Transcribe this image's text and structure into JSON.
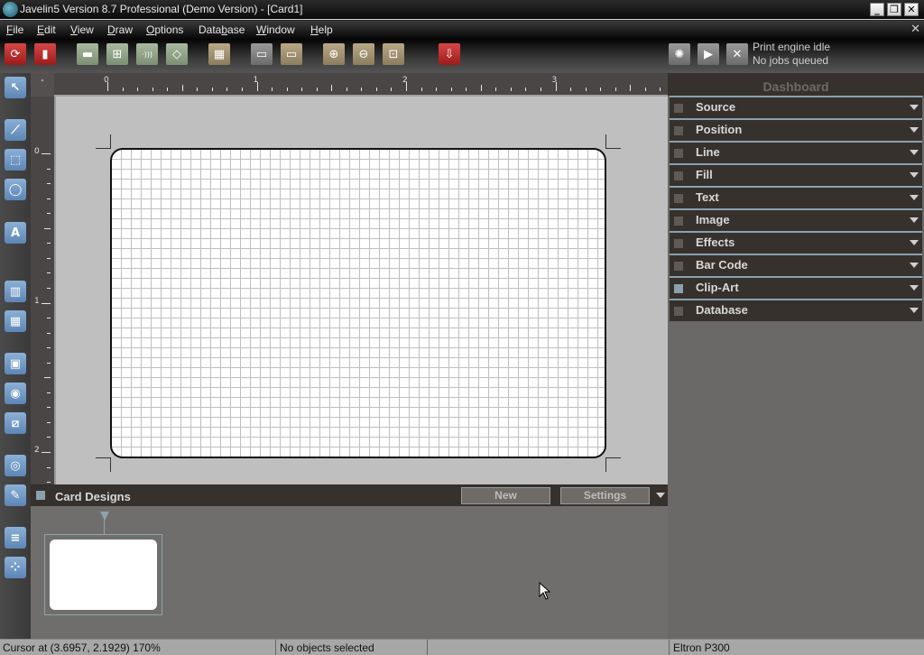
{
  "window": {
    "title": "Javelin5 Version 8.7 Professional (Demo Version) - [Card1]",
    "minimize": "_",
    "restore": "❐",
    "close": "✕",
    "mdi_close": "✕"
  },
  "menu": [
    {
      "label": "File",
      "u": "F",
      "rest": "ile"
    },
    {
      "label": "Edit",
      "u": "E",
      "rest": "dit"
    },
    {
      "label": "View",
      "u": "V",
      "rest": "iew"
    },
    {
      "label": "Draw",
      "u": "D",
      "rest": "raw"
    },
    {
      "label": "Options",
      "u": "O",
      "rest": "ptions"
    },
    {
      "label": "Database",
      "pre": "Data",
      "u": "b",
      "rest": "ase"
    },
    {
      "label": "Window",
      "u": "W",
      "rest": "indow"
    },
    {
      "label": "Help",
      "u": "H",
      "rest": "elp"
    }
  ],
  "toolbar": {
    "buttons": [
      {
        "name": "refresh-icon",
        "glyph": "⟳"
      },
      {
        "name": "ribbon-icon",
        "glyph": "▮"
      },
      {
        "name": "magstripe-icon",
        "glyph": "▬"
      },
      {
        "name": "smartchip-icon",
        "glyph": "⊞"
      },
      {
        "name": "contactless-icon",
        "glyph": "·)))"
      },
      {
        "name": "hologram-icon",
        "glyph": "◇"
      },
      {
        "name": "grid-icon",
        "glyph": "▦"
      },
      {
        "name": "card-front-icon",
        "glyph": "▭"
      },
      {
        "name": "card-flip-icon",
        "glyph": "▭"
      },
      {
        "name": "zoom-in-icon",
        "glyph": "⊕"
      },
      {
        "name": "zoom-out-icon",
        "glyph": "⊖"
      },
      {
        "name": "zoom-fit-icon",
        "glyph": "⊡"
      },
      {
        "name": "print-icon",
        "glyph": "⇩"
      },
      {
        "name": "print-settings-icon",
        "glyph": "✺"
      },
      {
        "name": "print-start-icon",
        "glyph": "▶"
      },
      {
        "name": "print-cancel-icon",
        "glyph": "✕"
      }
    ],
    "status_line1": "Print engine idle",
    "status_line2": "No jobs queued"
  },
  "tools": [
    {
      "name": "select-tool-icon",
      "glyph": "↖"
    },
    {
      "name": "line-tool-icon",
      "glyph": "⟋"
    },
    {
      "name": "rectangle-tool-icon",
      "glyph": "⬚"
    },
    {
      "name": "ellipse-tool-icon",
      "glyph": "◯"
    },
    {
      "name": "text-tool-icon",
      "glyph": "A"
    },
    {
      "name": "barcode-tool-icon",
      "glyph": "▥"
    },
    {
      "name": "2d-barcode-tool-icon",
      "glyph": "▦"
    },
    {
      "name": "image-tool-icon",
      "glyph": "▣"
    },
    {
      "name": "camera-tool-icon",
      "glyph": "◉"
    },
    {
      "name": "scanner-tool-icon",
      "glyph": "⧄"
    },
    {
      "name": "fingerprint-tool-icon",
      "glyph": "◎"
    },
    {
      "name": "signature-tool-icon",
      "glyph": "✎"
    },
    {
      "name": "magstripe-tool-icon",
      "glyph": "≡"
    },
    {
      "name": "smartcard-tool-icon",
      "glyph": "⁘"
    }
  ],
  "ruler": {
    "unit_mark": "\"",
    "h_labels": [
      "0",
      "1",
      "2",
      "3"
    ],
    "v_labels": [
      "0",
      "1",
      "2"
    ]
  },
  "card_designs": {
    "title": "Card Designs",
    "new_label": "New",
    "settings_label": "Settings"
  },
  "dashboard": {
    "title": "Dashboard",
    "items": [
      {
        "label": "Source",
        "active": false
      },
      {
        "label": "Position",
        "active": false
      },
      {
        "label": "Line",
        "active": false
      },
      {
        "label": "Fill",
        "active": false
      },
      {
        "label": "Text",
        "active": false
      },
      {
        "label": "Image",
        "active": false
      },
      {
        "label": "Effects",
        "active": false
      },
      {
        "label": "Bar Code",
        "active": false
      },
      {
        "label": "Clip-Art",
        "active": true
      },
      {
        "label": "Database",
        "active": false
      }
    ]
  },
  "statusbar": {
    "cursor": "Cursor at (3.6957, 2.1929) 170%",
    "selection": "No objects selected",
    "blank": "",
    "printer": "Eltron P300"
  }
}
